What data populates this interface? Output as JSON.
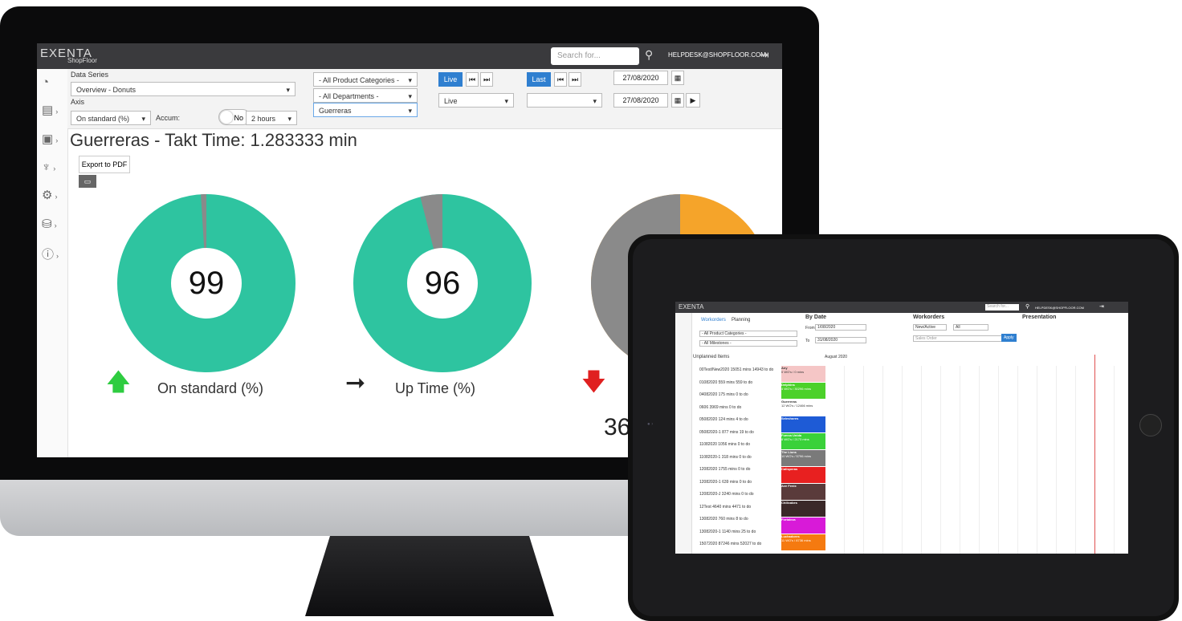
{
  "app": {
    "logo": "EXENTA",
    "logo_sub": "ShopFloor",
    "search_placeholder": "Search for...",
    "help_email": "HELPDESK@SHOPFLOOR.COM"
  },
  "filters": {
    "data_series_label": "Data Series",
    "data_series_value": "Overview - Donuts",
    "axis_label": "Axis",
    "axis_value": "On standard (%)",
    "accum_label": "Accum:",
    "accum_toggle": "No",
    "interval": "2 hours",
    "categories": "- All Product Categories -",
    "departments": "- All Departments -",
    "team": "Guerreras",
    "live_btn": "Live",
    "live_select": "Live",
    "last_btn": "Last",
    "last_select": "",
    "date_from": "27/08/2020",
    "date_to": "27/08/2020"
  },
  "page": {
    "title": "Guerreras - Takt Time: 1.283333 min",
    "export_label": "Export to PDF"
  },
  "donuts": [
    {
      "value": "99",
      "label": "On standard (%)",
      "pct": 99,
      "trend": "up"
    },
    {
      "value": "96",
      "label": "Up Time (%)",
      "pct": 96,
      "trend": "flat"
    },
    {
      "value": "36",
      "label": "",
      "pct": 36,
      "trend": "down"
    }
  ],
  "colors": {
    "teal": "#2ec4a0",
    "gray": "#8a8a8a",
    "orange": "#f5a42a",
    "green_arrow": "#2ecc40",
    "red_arrow": "#e02020"
  },
  "tablet": {
    "breadcrumb_1": "Workorders",
    "breadcrumb_2": "Planning",
    "by_date": "By Date",
    "from_label": "From",
    "from_value": "1/08/2020",
    "to_label": "To",
    "to_value": "31/08/2020",
    "workorders_label": "Workorders",
    "status": "New/Active",
    "status_all": "All",
    "sales_order": "Sales Order",
    "apply": "Apply",
    "presentation": "Presentation",
    "categories": "- All Product Categories -",
    "milestones": "- All Milestones -",
    "unplanned": "Unplanned Items",
    "month": "August 2020",
    "teams": [
      {
        "name": "Any",
        "sub": "0 WO's / 0 mins",
        "color": "#f5c6c6"
      },
      {
        "name": "Delphins",
        "sub": "4 WO's / 30296 mins",
        "color": "#4cd12a"
      },
      {
        "name": "Guerreras",
        "sub": "12 WO's / 12466 mins",
        "color": "#ffffff"
      },
      {
        "name": "Seleshores",
        "sub": "",
        "color": "#1e5bd6"
      },
      {
        "name": "Fuerza Unida",
        "sub": "8 WO's / 2173 mins",
        "color": "#3ad13a"
      },
      {
        "name": "The Lions",
        "sub": "10 WO's / 5796 mins",
        "color": "#7a7a7a"
      },
      {
        "name": "Calisperas",
        "sub": "",
        "color": "#e82020"
      },
      {
        "name": "Ave Fenix",
        "sub": "",
        "color": "#5a3b3b"
      },
      {
        "name": "Chilicabes",
        "sub": "",
        "color": "#3a2828"
      },
      {
        "name": "Fortaleza",
        "sub": "",
        "color": "#d81ad8"
      },
      {
        "name": "Luchadores",
        "sub": "11 WO's / 8736 mins",
        "color": "#f57a10"
      }
    ],
    "unplanned_items": [
      "00Test/New2020 15051 mins 14943 to do",
      "01082020 559 mins 559 to do",
      "04082020 175 mins 0 to do",
      "0606 3969 mins 0 to do",
      "05082020 124 mins 4 to do",
      "05082020-1 877 mins 19 to do",
      "11082020 1056 mins 0 to do",
      "11082020-1 318 mins 0 to do",
      "12082020 1755 mins 0 to do",
      "12082020-1 639 mins 0 to do",
      "12082020-J 3240 mins 0 to do",
      "12Test 4640 mins 4471 to do",
      "13082020 760 mins 8 to do",
      "13082020-1 1140 mins 25 to do",
      "15072020 87246 mins 52027 to do"
    ]
  }
}
